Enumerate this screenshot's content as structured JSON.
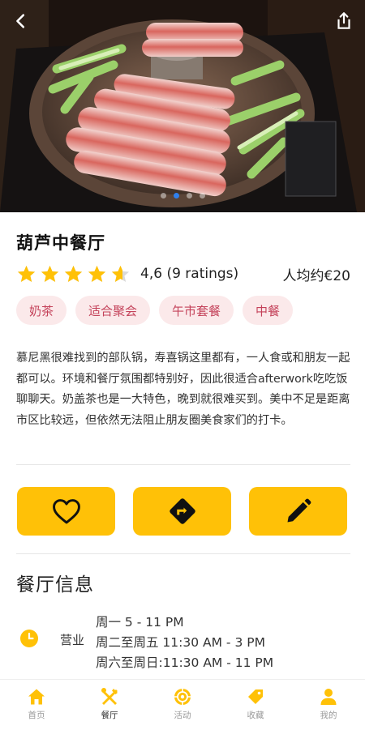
{
  "colors": {
    "accent": "#ffc107",
    "tag_bg": "#fbe9ea",
    "tag_text": "#c4425a",
    "carousel_active_dot": "#2f80ed"
  },
  "header": {
    "back_icon": "chevron-left-icon",
    "share_icon": "share-icon",
    "carousel": {
      "total": 4,
      "active_index": 1
    }
  },
  "restaurant": {
    "name": "葫芦中餐厅",
    "rating_value": 4.6,
    "rating_text": "4,6 (9 ratings)",
    "price_text": "人均约€20",
    "tags": [
      "奶茶",
      "适合聚会",
      "午市套餐",
      "中餐"
    ],
    "description": "慕尼黑很难找到的部队锅，寿喜锅这里都有，一人食或和朋友一起都可以。环境和餐厅氛围都特别好，因此很适合afterwork吃吃饭聊聊天。奶盖茶也是一大特色，晚到就很难买到。美中不足是距离市区比较远，但依然无法阻止朋友圈美食家们的打卡。"
  },
  "actions": [
    {
      "name": "favorite",
      "icon": "heart-icon"
    },
    {
      "name": "directions",
      "icon": "directions-icon"
    },
    {
      "name": "edit",
      "icon": "pencil-icon"
    }
  ],
  "info": {
    "section_title": "餐厅信息",
    "hours_label": "营业",
    "hours_icon": "clock-icon",
    "hours": [
      "周一 5 - 11 PM",
      "周二至周五 11:30 AM - 3 PM",
      "周六至周日:11:30 AM - 11 PM"
    ]
  },
  "nav": [
    {
      "label": "首页",
      "icon": "home-icon",
      "active": false
    },
    {
      "label": "餐厅",
      "icon": "utensils-icon",
      "active": true
    },
    {
      "label": "活动",
      "icon": "activity-icon",
      "active": false
    },
    {
      "label": "收藏",
      "icon": "tag-icon",
      "active": false
    },
    {
      "label": "我的",
      "icon": "user-icon",
      "active": false
    }
  ]
}
